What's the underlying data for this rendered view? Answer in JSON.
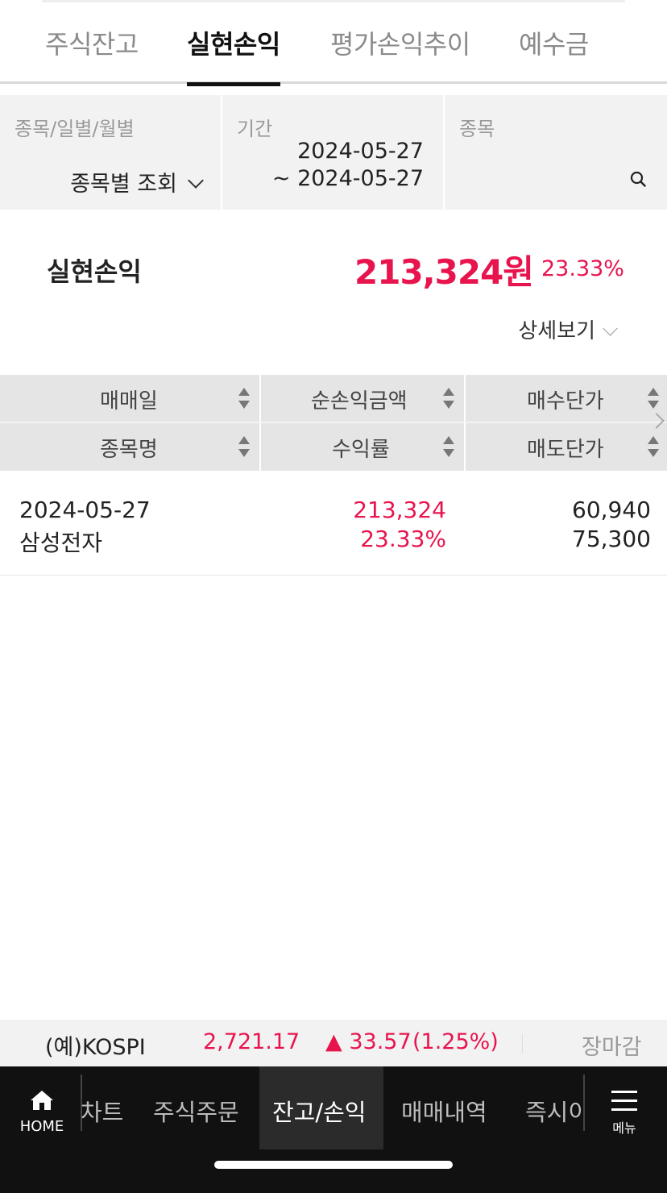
{
  "tabs": [
    {
      "label": "주식잔고"
    },
    {
      "label": "실현손익"
    },
    {
      "label": "평가손익추이"
    },
    {
      "label": "예수금"
    }
  ],
  "active_tab": "실현손익",
  "filters": {
    "mode_label": "종목/일별/월별",
    "mode_value": "종목별 조회",
    "period_label": "기간",
    "period_from": "2024-05-27",
    "period_to": "~ 2024-05-27",
    "stock_label": "종목"
  },
  "summary": {
    "label": "실현손익",
    "amount": "213,324원",
    "rate": "23.33%",
    "detail_label": "상세보기"
  },
  "table": {
    "headers_row1": [
      "매매일",
      "순손익금액",
      "매수단가"
    ],
    "headers_row2": [
      "종목명",
      "수익률",
      "매도단가"
    ],
    "rows": [
      {
        "date": "2024-05-27",
        "name": "삼성전자",
        "net_profit": "213,324",
        "rate": "23.33%",
        "buy_price": "60,940",
        "sell_price": "75,300"
      }
    ]
  },
  "ticker": {
    "index_name": "(예)KOSPI",
    "value": "2,721.17",
    "change": "▲ 33.57",
    "change_pct": "(1.25%)",
    "market_status": "장마감"
  },
  "bottom_nav": {
    "home_label": "HOME",
    "items": [
      "차트",
      "주식주문",
      "잔고/손익",
      "매매내역",
      "즉시이"
    ],
    "active": "잔고/손익",
    "menu_label": "메뉴"
  },
  "colors": {
    "accent_red": "#e8144e",
    "nav_bg": "#111111"
  }
}
